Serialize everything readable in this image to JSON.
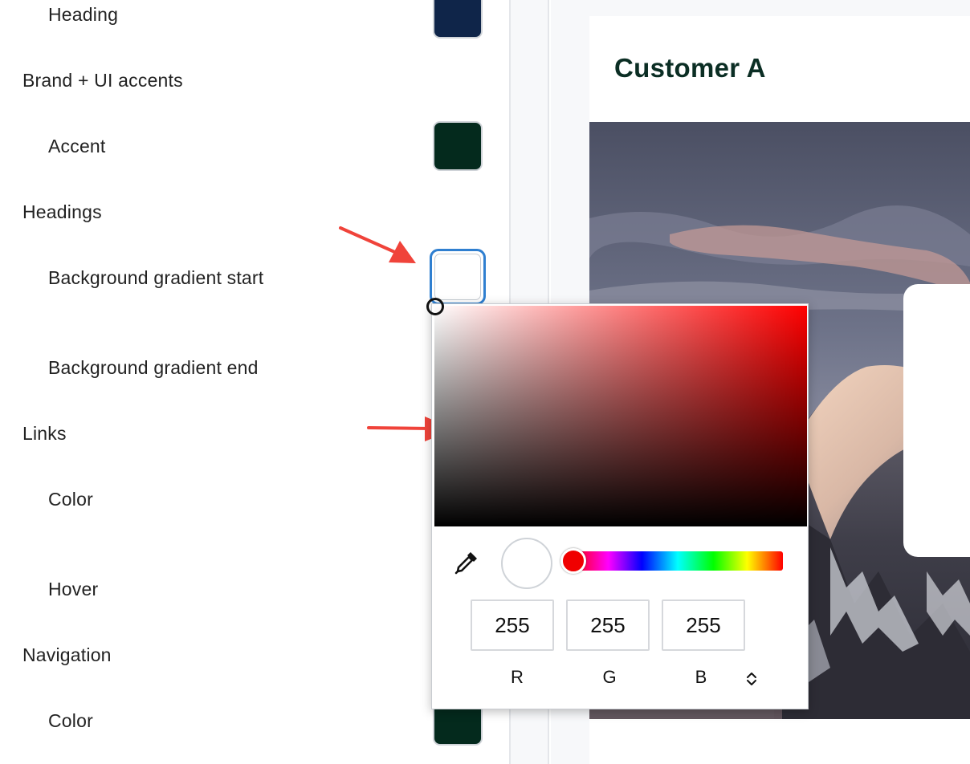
{
  "settings": {
    "heading_item": {
      "label": "Heading",
      "color": "#0f2549"
    },
    "brand_section": "Brand + UI accents",
    "accent_item": {
      "label": "Accent",
      "color": "#042a1d"
    },
    "headings_section": "Headings",
    "bg_gradient_start": {
      "label": "Background gradient start",
      "color": "#ffffff"
    },
    "bg_gradient_end": {
      "label": "Background gradient end"
    },
    "links_section": "Links",
    "links_color": {
      "label": "Color"
    },
    "links_hover": {
      "label": "Hover"
    },
    "navigation_section": "Navigation",
    "nav_color": {
      "label": "Color",
      "color": "#042a1d"
    }
  },
  "preview": {
    "title": "Customer A",
    "title_color": "#0b2e24"
  },
  "color_picker": {
    "hue_color": "#ff0000",
    "selected_color": "#ffffff",
    "r": "255",
    "g": "255",
    "b": "255",
    "r_label": "R",
    "g_label": "G",
    "b_label": "B",
    "eyedropper_icon": "eyedropper-icon",
    "mode_toggle_icon": "chevron-up-down-icon"
  },
  "annotations": {
    "arrow_color": "#f0433a"
  }
}
